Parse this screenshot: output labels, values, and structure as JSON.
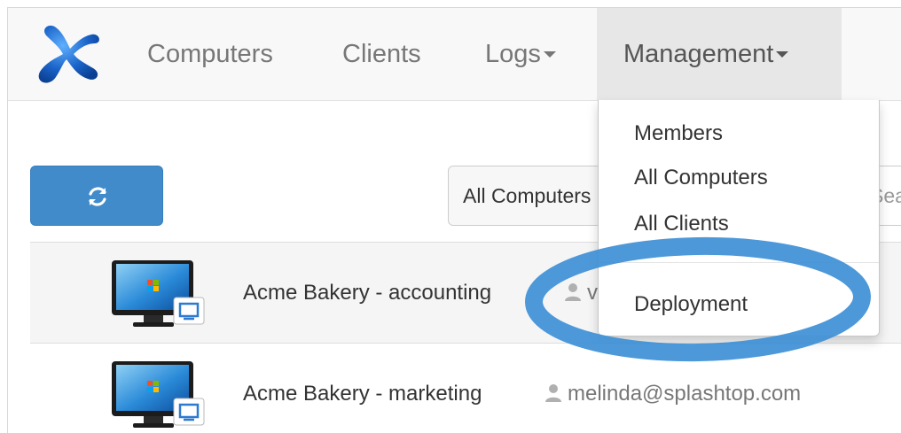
{
  "navbar": {
    "logo": "splashtop-logo",
    "items": [
      {
        "label": "Computers"
      },
      {
        "label": "Clients"
      },
      {
        "label": "Logs"
      },
      {
        "label": "Management"
      }
    ]
  },
  "toolbar": {
    "refresh_icon": "refresh-icon",
    "filter_value": "All Computers",
    "search_placeholder": "Search"
  },
  "computers": [
    {
      "name": "Acme Bakery - accounting",
      "user": "v"
    },
    {
      "name": "Acme Bakery - marketing",
      "user": "melinda@splashtop.com"
    }
  ],
  "management_menu": {
    "items": [
      {
        "label": "Members"
      },
      {
        "label": "All Computers"
      },
      {
        "label": "All Clients"
      },
      {
        "label": "Deployment"
      }
    ],
    "highlighted": "Deployment"
  },
  "colors": {
    "primary_button": "#428bca",
    "highlight_ring": "#3d8fd6",
    "logo_blue": "#1a63c8"
  }
}
